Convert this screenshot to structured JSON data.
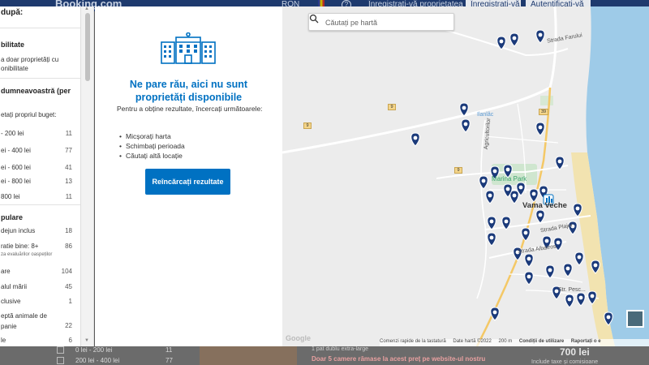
{
  "header": {
    "logo": "Booking.com",
    "currency": "RON",
    "help": "?",
    "list_property": "Înregistrați-vă proprietatea",
    "register": "Înregistrați-vă",
    "sign_in": "Autentificați-vă"
  },
  "sidebar": {
    "title": "după:",
    "section_availability": "bilitate",
    "availability_option": "a doar proprietăți cu",
    "availability_option2": "onibilitate",
    "section_budget": "dumneavoastră (per",
    "budget_custom": "etați propriul buget:",
    "budget_ranges": [
      {
        "label": "- 200 lei",
        "count": "11"
      },
      {
        "label": "ei - 400 lei",
        "count": "77"
      },
      {
        "label": "ei - 600 lei",
        "count": "41"
      },
      {
        "label": "ei - 800 lei",
        "count": "13"
      },
      {
        "label": "800 lei",
        "count": "11"
      }
    ],
    "section_popular": "pulare",
    "popular_items": [
      {
        "label": "dejun inclus",
        "count": "18"
      },
      {
        "label": "ratie bine: 8+",
        "count": "86"
      },
      {
        "label": "are",
        "count": "104"
      },
      {
        "label": "alul mării",
        "count": "45"
      },
      {
        "label": "clusive",
        "count": "1"
      },
      {
        "label": "eptă animale de",
        "count": "22"
      },
      {
        "label": "le",
        "count": "6"
      }
    ],
    "popular_sub": "za evaluărilor oaspeților",
    "popular_item_cont": "panie"
  },
  "panel": {
    "title": "Ne pare rău, aici nu sunt proprietăți disponibile",
    "intro": "Pentru a obține rezultate, încercați următoarele:",
    "suggestions": [
      "Micșorați harta",
      "Schimbați perioada",
      "Căutați altă locație"
    ],
    "reload_button": "Reîncărcați rezultate"
  },
  "map": {
    "search_placeholder": "Căutați pe hartă",
    "labels": {
      "town": "Vama Veche",
      "marina": "Marina Park",
      "ilanlac": "Ilanlâc",
      "strada_farului": "Strada Farului",
      "strada_albatros": "Strada Albatros",
      "strada_plajei": "Strada Plajei",
      "agricultorilor": "Agricultorilor",
      "road_9a": "9",
      "road_9b": "9",
      "road_9c": "9",
      "road_39": "39",
      "str_pesc": "Str. Pesc..."
    },
    "footer": {
      "shortcuts": "Comenzi rapide de la tastatură",
      "map_data": "Date hartă ©2022",
      "scale": "200 m",
      "terms": "Condiții de utilizare",
      "report": "Raportați o e"
    },
    "google": "Google"
  },
  "background_list": {
    "filter_rows": [
      {
        "label": "0 lei - 200 lei",
        "count": "11"
      },
      {
        "label": "200 lei - 400 lei",
        "count": "77"
      }
    ],
    "bed_info": "1 pat dublu extra-large",
    "warning": "Doar 5 camere rămase la acest preț pe website-ul nostru",
    "price": "700 lei",
    "taxes": "Include taxe și comisioane"
  },
  "colors": {
    "brand_blue": "#0071c2",
    "header_navy": "#1e3a6e",
    "pin_navy": "#1b3a7a",
    "sea": "#9ecbe8",
    "beach": "#f2e3b0"
  }
}
